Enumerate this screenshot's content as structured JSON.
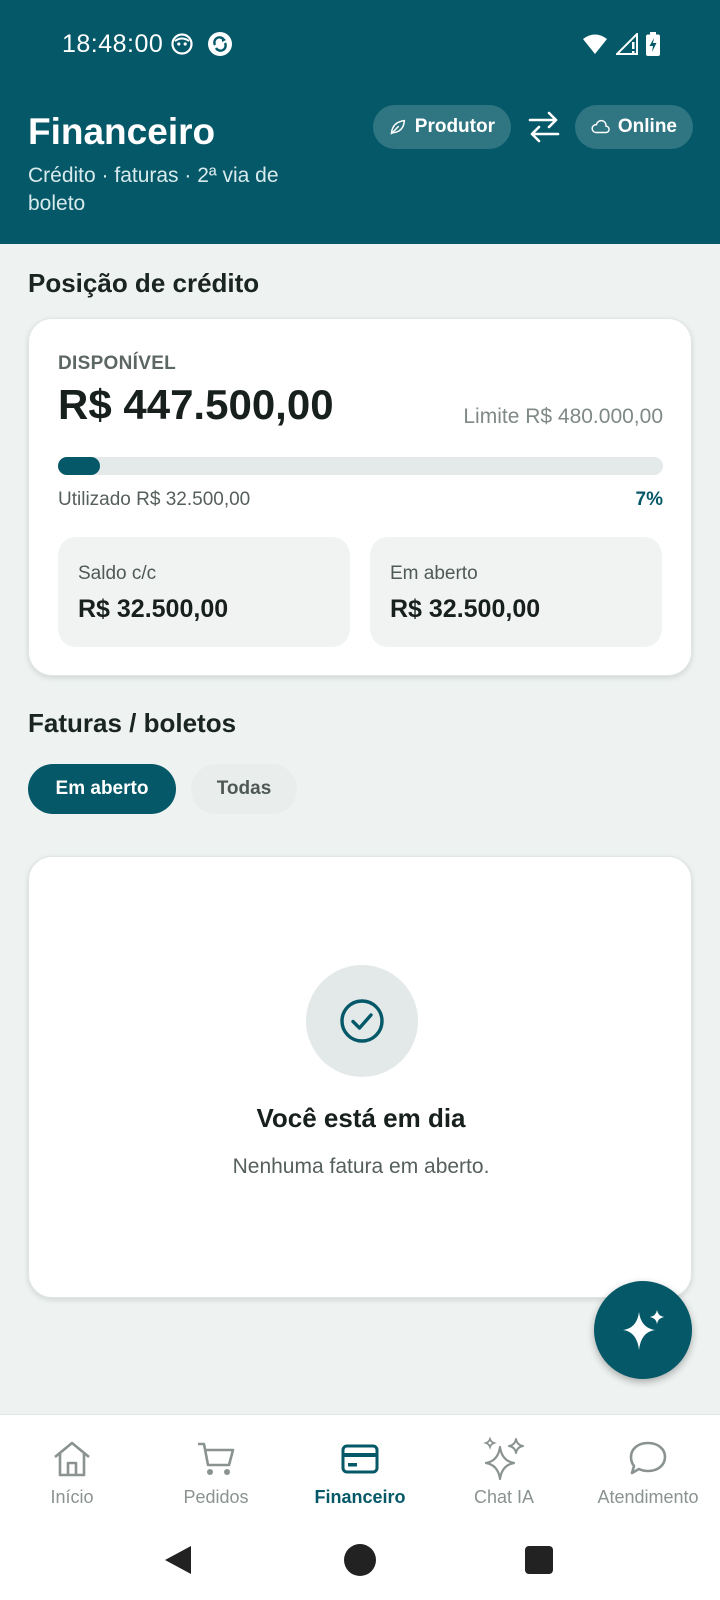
{
  "status_bar": {
    "time": "18:48:00",
    "left_icons": [
      "robot-face-icon",
      "sync-icon"
    ],
    "right_icons": [
      "wifi-icon",
      "signal-icon",
      "battery-charging-icon"
    ]
  },
  "header": {
    "title": "Financeiro",
    "subtitle": "Crédito · faturas · 2ª via de boleto",
    "profile_pill": {
      "label": "Produtor",
      "icon": "leaf-icon"
    },
    "swap_icon": "swap-arrows-icon",
    "status_pill": {
      "label": "Online",
      "icon": "cloud-icon"
    }
  },
  "credit": {
    "section_title": "Posição de crédito",
    "available_label": "DISPONÍVEL",
    "available_value": "R$ 447.500,00",
    "limit_text": "Limite R$ 480.000,00",
    "used_text": "Utilizado R$ 32.500,00",
    "used_percent_text": "7%",
    "used_fraction": 0.07,
    "balance_label": "Saldo c/c",
    "balance_value": "R$ 32.500,00",
    "open_label": "Em aberto",
    "open_value": "R$ 32.500,00"
  },
  "invoices": {
    "section_title": "Faturas / boletos",
    "filter_active": "Em aberto",
    "filter_other": "Todas",
    "empty_icon": "check-circle-icon",
    "empty_title": "Você está em dia",
    "empty_subtitle": "Nenhuma fatura em aberto."
  },
  "fab": {
    "icon": "sparkles-icon"
  },
  "bottom_nav": {
    "items": [
      {
        "label": "Início",
        "icon": "home-icon"
      },
      {
        "label": "Pedidos",
        "icon": "cart-icon"
      },
      {
        "label": "Financeiro",
        "icon": "credit-card-icon"
      },
      {
        "label": "Chat IA",
        "icon": "sparkles-icon"
      },
      {
        "label": "Atendimento",
        "icon": "chat-bubble-icon"
      }
    ],
    "active_index": 2
  },
  "colors": {
    "primary": "#055868",
    "background": "#eef3f1",
    "card": "#ffffff"
  }
}
